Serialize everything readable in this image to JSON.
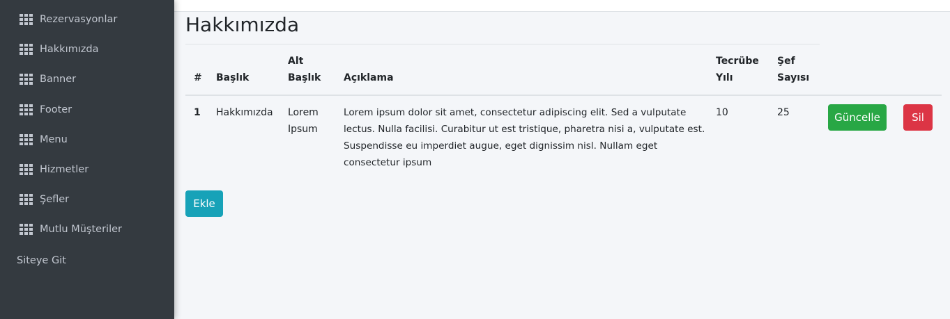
{
  "sidebar": {
    "items": [
      {
        "label": "Rezervasyonlar",
        "icon": "grid-icon"
      },
      {
        "label": "Hakkımızda",
        "icon": "grid-icon"
      },
      {
        "label": "Banner",
        "icon": "grid-icon"
      },
      {
        "label": "Footer",
        "icon": "grid-icon"
      },
      {
        "label": "Menu",
        "icon": "grid-icon"
      },
      {
        "label": "Hizmetler",
        "icon": "grid-icon"
      },
      {
        "label": "Şefler",
        "icon": "grid-icon"
      },
      {
        "label": "Mutlu Müşteriler",
        "icon": "grid-icon"
      }
    ],
    "site_link": "Siteye Git"
  },
  "main": {
    "title": "Hakkımızda",
    "table": {
      "headers": {
        "index": "#",
        "title": "Başlık",
        "subtitle_line1": "Alt",
        "subtitle_line2": "Başlık",
        "description": "Açıklama",
        "experience_line1": "Tecrübe",
        "experience_line2": "Yılı",
        "chefs_line1": "Şef",
        "chefs_line2": "Sayısı"
      },
      "rows": [
        {
          "index": "1",
          "title": "Hakkımızda",
          "subtitle_line1": "Lorem",
          "subtitle_line2": "Ipsum",
          "description_lines": [
            "Lorem ipsum dolor sit amet, consectetur adipiscing elit. Sed a vulputate",
            "lectus. Nulla facilisi. Curabitur ut est tristique, pharetra nisi a, vulputate est.",
            "Suspendisse eu imperdiet augue, eget dignissim nisl. Nullam eget",
            "consectetur ipsum"
          ],
          "experience": "10",
          "chefs": "25",
          "update_label": "Güncelle",
          "delete_label": "Sil"
        }
      ]
    },
    "add_label": "Ekle"
  },
  "colors": {
    "sidebar_bg": "#343a40",
    "content_bg": "#f4f6f9",
    "success": "#28a745",
    "danger": "#dc3545",
    "info": "#17a2b8"
  }
}
